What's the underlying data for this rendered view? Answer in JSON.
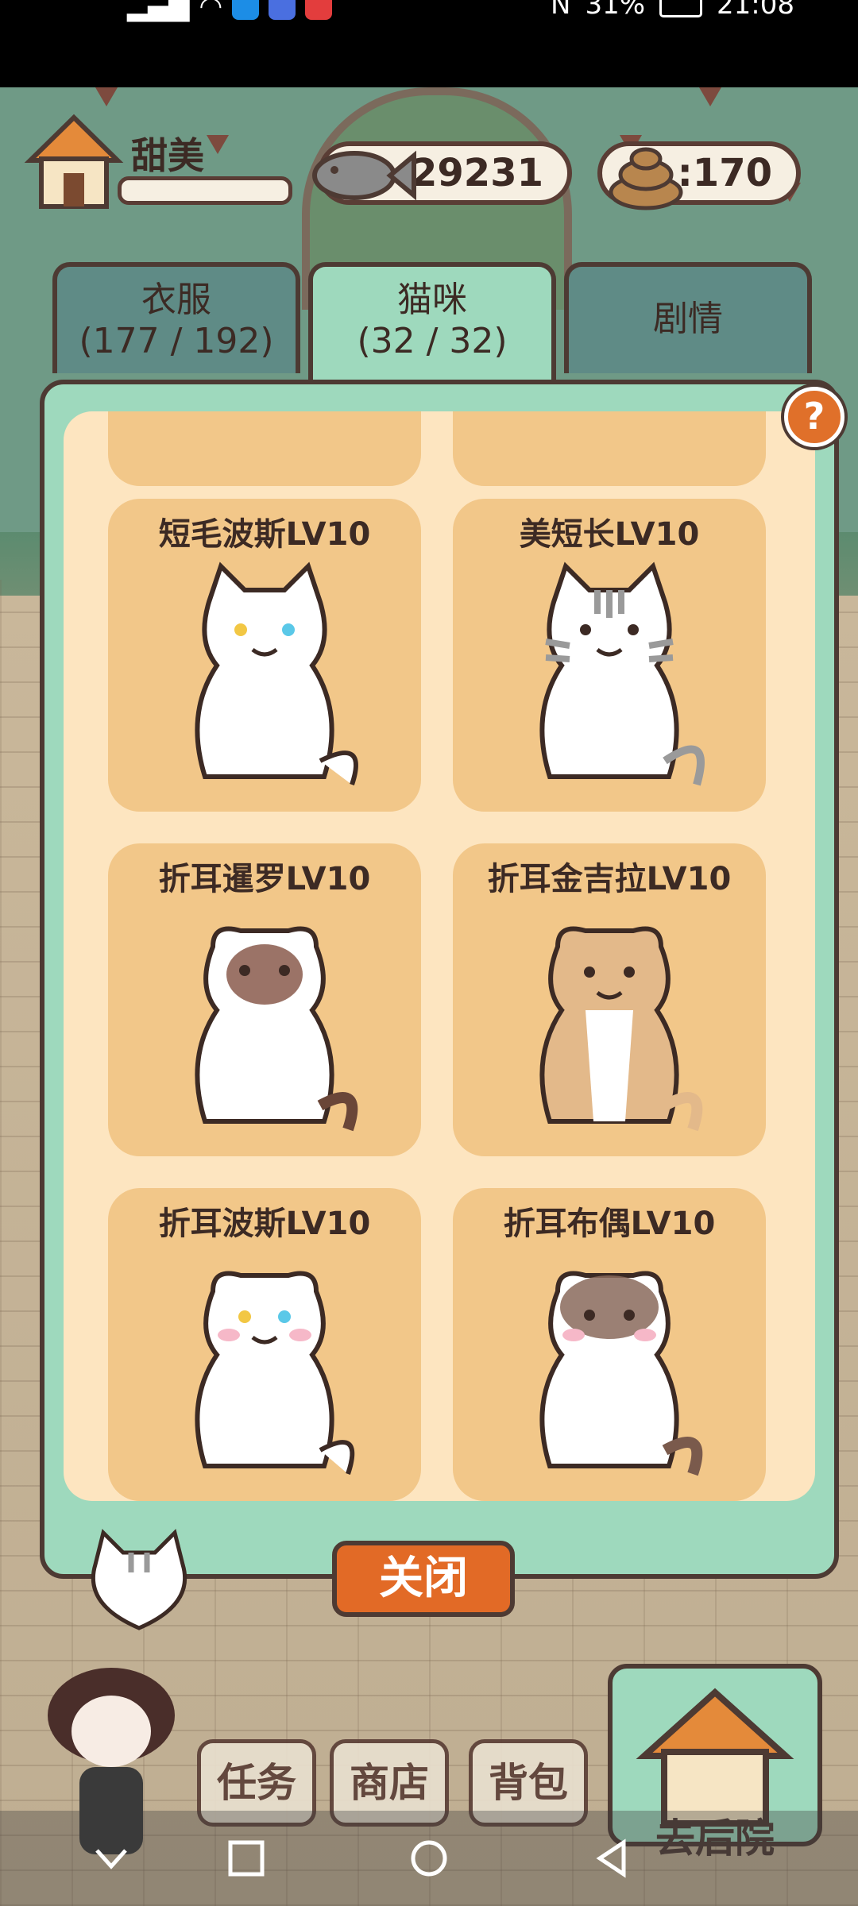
{
  "status_bar": {
    "battery": "31%",
    "time": "21:08"
  },
  "header": {
    "player_name": "甜美",
    "fish_coins": ":29231",
    "poop_coins": ":170"
  },
  "tabs": [
    {
      "label": "衣服",
      "count": "(177 / 192)"
    },
    {
      "label": "猫咪",
      "count": "(32 / 32)"
    },
    {
      "label": "剧情"
    }
  ],
  "cats": [
    {
      "name": "短毛波斯LV10"
    },
    {
      "name": "美短长LV10"
    },
    {
      "name": "折耳暹罗LV10"
    },
    {
      "name": "折耳金吉拉LV10"
    },
    {
      "name": "折耳波斯LV10"
    },
    {
      "name": "折耳布偶LV10"
    }
  ],
  "buttons": {
    "close": "关闭",
    "help": "?"
  },
  "bottom_menu": {
    "tasks": "任务",
    "shop": "商店",
    "bag": "背包",
    "backyard": "去后院"
  },
  "colors": {
    "panel_mint": "#9ed9bd",
    "card_tan": "#f2c789",
    "inner_cream": "#fde5c0",
    "close_orange": "#e26a26"
  }
}
